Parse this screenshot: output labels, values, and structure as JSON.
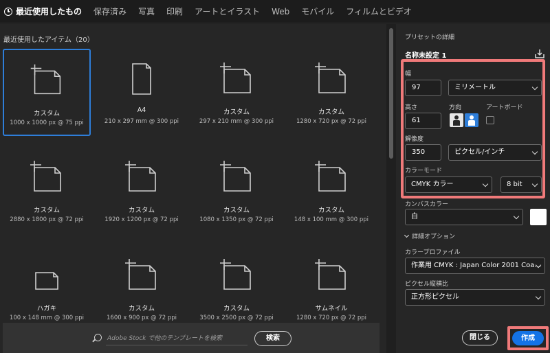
{
  "tabs": [
    {
      "label": "最近使用したもの",
      "icon": "clock-icon",
      "active": true
    },
    {
      "label": "保存済み"
    },
    {
      "label": "写真"
    },
    {
      "label": "印刷"
    },
    {
      "label": "アートとイラスト"
    },
    {
      "label": "Web"
    },
    {
      "label": "モバイル"
    },
    {
      "label": "フィルムとビデオ"
    }
  ],
  "recent": {
    "title": "最近使用したアイテム（20）",
    "items": [
      {
        "name": "カスタム",
        "size": "1000 x 1000 px @ 75 ppi",
        "icon": "custom-document-icon",
        "selected": true
      },
      {
        "name": "A4",
        "size": "210 x 297 mm @ 300 ppi",
        "icon": "portrait-document-icon"
      },
      {
        "name": "カスタム",
        "size": "297 x 210 mm @ 300 ppi",
        "icon": "custom-document-icon"
      },
      {
        "name": "カスタム",
        "size": "1280 x 720 px @ 72 ppi",
        "icon": "custom-document-icon"
      },
      {
        "name": "カスタム",
        "size": "2880 x 1800 px @ 72 ppi",
        "icon": "custom-document-icon"
      },
      {
        "name": "カスタム",
        "size": "1920 x 1200 px @ 72 ppi",
        "icon": "custom-document-icon"
      },
      {
        "name": "カスタム",
        "size": "1080 x 1350 px @ 72 ppi",
        "icon": "custom-document-icon"
      },
      {
        "name": "カスタム",
        "size": "148 x 100 mm @ 300 ppi",
        "icon": "custom-document-icon"
      },
      {
        "name": "ハガキ",
        "size": "100 x 148 mm @ 300 ppi",
        "icon": "landscape-document-icon"
      },
      {
        "name": "カスタム",
        "size": "1600 x 900 px @ 72 ppi",
        "icon": "custom-document-icon"
      },
      {
        "name": "カスタム",
        "size": "3500 x 2500 px @ 72 ppi",
        "icon": "custom-document-icon"
      },
      {
        "name": "サムネイル",
        "size": "1280 x 720 px @ 72 ppi",
        "icon": "custom-document-icon"
      }
    ]
  },
  "search": {
    "placeholder": "Adobe Stock で他のテンプレートを検索",
    "button": "検索"
  },
  "preset": {
    "header": "プリセットの詳細",
    "name": "名称未設定 1",
    "width_label": "幅",
    "width_value": "97",
    "unit": "ミリメートル",
    "height_label": "高さ",
    "height_value": "61",
    "orientation_label": "方向",
    "artboard_label": "アートボード",
    "resolution_label": "解像度",
    "resolution_value": "350",
    "resolution_unit": "ピクセル/インチ",
    "color_mode_label": "カラーモード",
    "color_mode": "CMYK カラー",
    "bit_depth": "8 bit",
    "canvas_color_label": "カンバスカラー",
    "canvas_color": "白",
    "canvas_swatch": "#ffffff",
    "advanced_label": "詳細オプション",
    "profile_label": "カラープロファイル",
    "profile": "作業用 CMYK : Japan Color 2001 Coa...",
    "pixel_aspect_label": "ピクセル縦横比",
    "pixel_aspect": "正方形ピクセル"
  },
  "actions": {
    "close": "閉じる",
    "create": "作成"
  },
  "colors": {
    "accent": "#1473e6",
    "highlight": "#f07a7a"
  }
}
